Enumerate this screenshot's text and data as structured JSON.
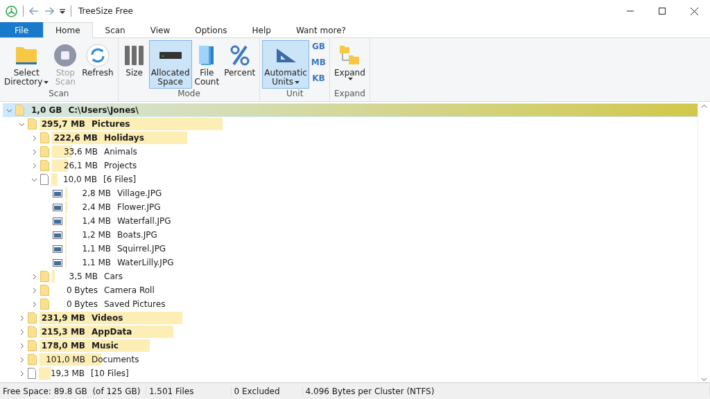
{
  "window": {
    "title": "TreeSize Free"
  },
  "tabs": [
    {
      "label": "File",
      "kind": "file",
      "selected": false
    },
    {
      "label": "Home",
      "kind": "tab",
      "selected": true
    },
    {
      "label": "Scan",
      "kind": "tab",
      "selected": false
    },
    {
      "label": "View",
      "kind": "tab",
      "selected": false
    },
    {
      "label": "Options",
      "kind": "tab",
      "selected": false
    },
    {
      "label": "Help",
      "kind": "tab",
      "selected": false
    },
    {
      "label": "Want more?",
      "kind": "tab",
      "selected": false
    }
  ],
  "ribbon_groups": [
    {
      "label": "Scan",
      "buttons": [
        {
          "lines": [
            "Select",
            "Directory"
          ],
          "dropdown": true,
          "selected": false,
          "disabled": false
        },
        {
          "lines": [
            "Stop",
            "Scan"
          ],
          "dropdown": false,
          "selected": false,
          "disabled": true
        },
        {
          "lines": [
            "Refresh"
          ],
          "dropdown": false,
          "selected": false,
          "disabled": false
        }
      ]
    },
    {
      "label": "Mode",
      "buttons": [
        {
          "lines": [
            "Size"
          ],
          "dropdown": false,
          "selected": false,
          "disabled": false
        },
        {
          "lines": [
            "Allocated",
            "Space"
          ],
          "dropdown": false,
          "selected": true,
          "disabled": false
        },
        {
          "lines": [
            "File",
            "Count"
          ],
          "dropdown": false,
          "selected": false,
          "disabled": false
        },
        {
          "lines": [
            "Percent"
          ],
          "dropdown": false,
          "selected": false,
          "disabled": false
        }
      ]
    },
    {
      "label": "Unit",
      "buttons": [
        {
          "lines": [
            "Automatic",
            "Units"
          ],
          "dropdown": true,
          "selected": true,
          "disabled": false
        }
      ],
      "units": [
        "GB",
        "MB",
        "KB"
      ]
    },
    {
      "label": "Expand",
      "buttons": [
        {
          "lines": [
            "Expand"
          ],
          "dropdown": true,
          "selected": false,
          "disabled": false
        }
      ]
    }
  ],
  "tree": [
    {
      "kind": "folder",
      "size": "1,0 GB",
      "name": "C:\\Users\\Jones\\",
      "bold": true,
      "expanded": true,
      "selected": true,
      "level": 1,
      "children": [
        {
          "kind": "folder",
          "size": "295,7 MB",
          "name": "Pictures",
          "bold": true,
          "expanded": true,
          "selected": false,
          "level": 0.278,
          "children": [
            {
              "kind": "folder",
              "size": "222,6 MB",
              "name": "Holidays",
              "bold": true,
              "expanded": false,
              "selected": false,
              "level": 0.209
            },
            {
              "kind": "folder",
              "size": "33,6 MB",
              "name": "Animals",
              "bold": false,
              "expanded": false,
              "selected": false,
              "level": 0.031
            },
            {
              "kind": "folder",
              "size": "26,1 MB",
              "name": "Projects",
              "bold": false,
              "expanded": false,
              "selected": false,
              "level": 0.025
            },
            {
              "kind": "files",
              "size": "10,0 MB",
              "name": "[6 Files]",
              "bold": false,
              "expanded": true,
              "selected": false,
              "level": 0.01,
              "children": [
                {
                  "kind": "image",
                  "size": "2,8 MB",
                  "name": "Village.JPG",
                  "bold": false,
                  "selected": false,
                  "level": 0.003
                },
                {
                  "kind": "image",
                  "size": "2,4 MB",
                  "name": "Flower.JPG",
                  "bold": false,
                  "selected": false,
                  "level": 0.003
                },
                {
                  "kind": "image",
                  "size": "1,4 MB",
                  "name": "Waterfall.JPG",
                  "bold": false,
                  "selected": false,
                  "level": 0.002
                },
                {
                  "kind": "image",
                  "size": "1,2 MB",
                  "name": "Boats.JPG",
                  "bold": false,
                  "selected": false,
                  "level": 0.002
                },
                {
                  "kind": "image",
                  "size": "1,1 MB",
                  "name": "Squirrel.JPG",
                  "bold": false,
                  "selected": false,
                  "level": 0.002
                },
                {
                  "kind": "image",
                  "size": "1,1 MB",
                  "name": "WaterLilly.JPG",
                  "bold": false,
                  "selected": false,
                  "level": 0.002
                }
              ]
            },
            {
              "kind": "folder",
              "size": "3,5 MB",
              "name": "Cars",
              "bold": false,
              "expanded": false,
              "selected": false,
              "level": 0.004
            },
            {
              "kind": "folder",
              "size": "0 Bytes",
              "name": "Camera Roll",
              "bold": false,
              "expanded": false,
              "selected": false
            },
            {
              "kind": "folder",
              "size": "0 Bytes",
              "name": "Saved Pictures",
              "bold": false,
              "expanded": false,
              "selected": false
            }
          ]
        },
        {
          "kind": "folder",
          "size": "231,9 MB",
          "name": "Videos",
          "bold": true,
          "expanded": false,
          "selected": false,
          "level": 0.217
        },
        {
          "kind": "folder",
          "size": "215,3 MB",
          "name": "AppData",
          "bold": true,
          "expanded": false,
          "selected": false,
          "level": 0.203
        },
        {
          "kind": "folder",
          "size": "178,0 MB",
          "name": "Music",
          "bold": true,
          "expanded": false,
          "selected": false,
          "level": 0.168
        },
        {
          "kind": "folder",
          "size": "101,0 MB",
          "name": "Documents",
          "bold": false,
          "expanded": false,
          "selected": false,
          "level": 0.094
        },
        {
          "kind": "files",
          "size": "19,3 MB",
          "name": "[10 Files]",
          "bold": false,
          "expanded": false,
          "selected": false,
          "level": 0.018
        }
      ]
    }
  ],
  "status_bar": [
    "Free Space: 89.8 GB  (of 125 GB)",
    "1.501 Files",
    "0 Excluded",
    "4.096 Bytes per Cluster (NTFS)"
  ]
}
